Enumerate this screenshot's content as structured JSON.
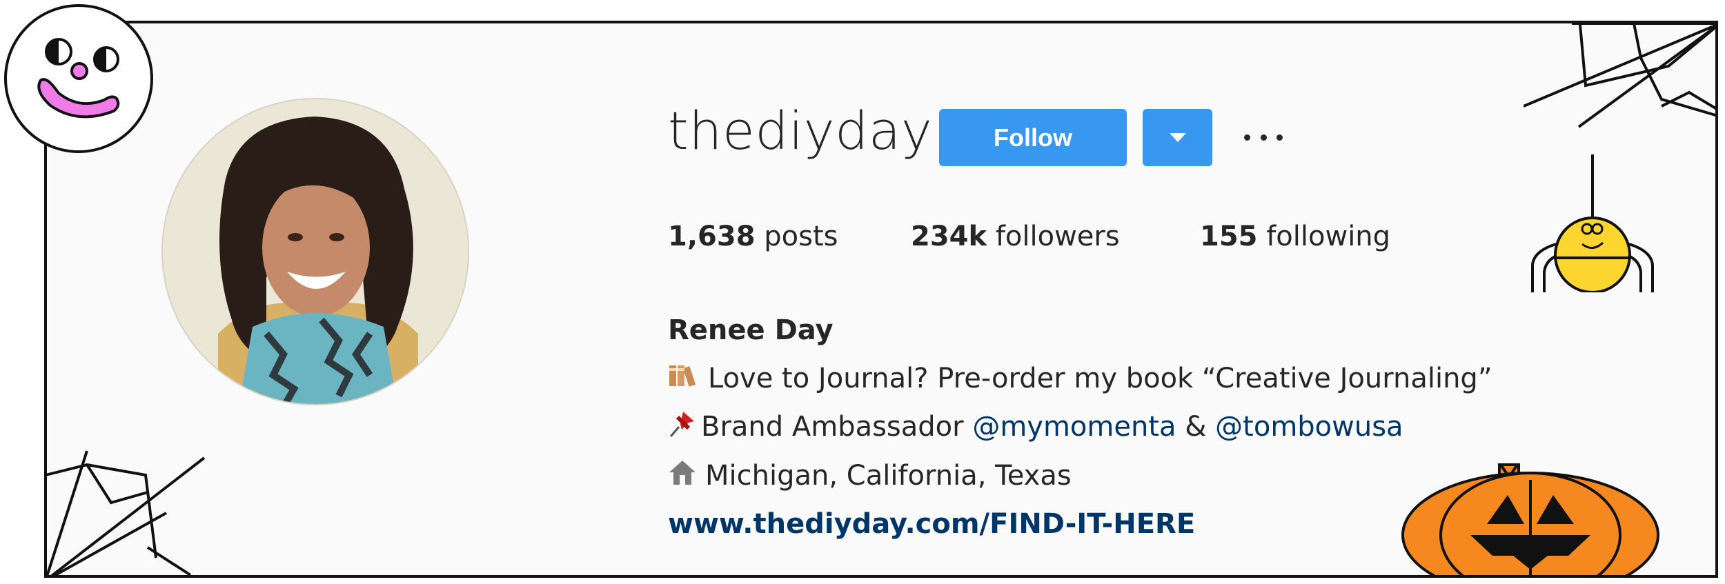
{
  "profile": {
    "username": "thediyday",
    "follow_label": "Follow",
    "stats": {
      "posts_count": "1,638",
      "posts_label": "posts",
      "followers_count": "234k",
      "followers_label": "followers",
      "following_count": "155",
      "following_label": "following"
    },
    "bio": {
      "name": "Renee Day",
      "line1_text": "Love to Journal? Pre-order my book “Creative Journaling”",
      "line2_text": "Brand Ambassador",
      "line2_mention1": "@mymomenta",
      "line2_amp": "&",
      "line2_mention2": "@tombowusa",
      "line3_text": "Michigan, California, Texas",
      "website": "www.thediyday.com/FIND-IT-HERE"
    }
  },
  "icons": {
    "line1": "books-emoji-icon",
    "line2": "pushpin-emoji-icon",
    "line3": "house-icon"
  },
  "colors": {
    "follow_blue": "#3897f0",
    "link_blue": "#003569",
    "pumpkin_orange": "#f5891f",
    "spider_yellow": "#fcd52e",
    "clown_pink": "#f07ce8"
  }
}
